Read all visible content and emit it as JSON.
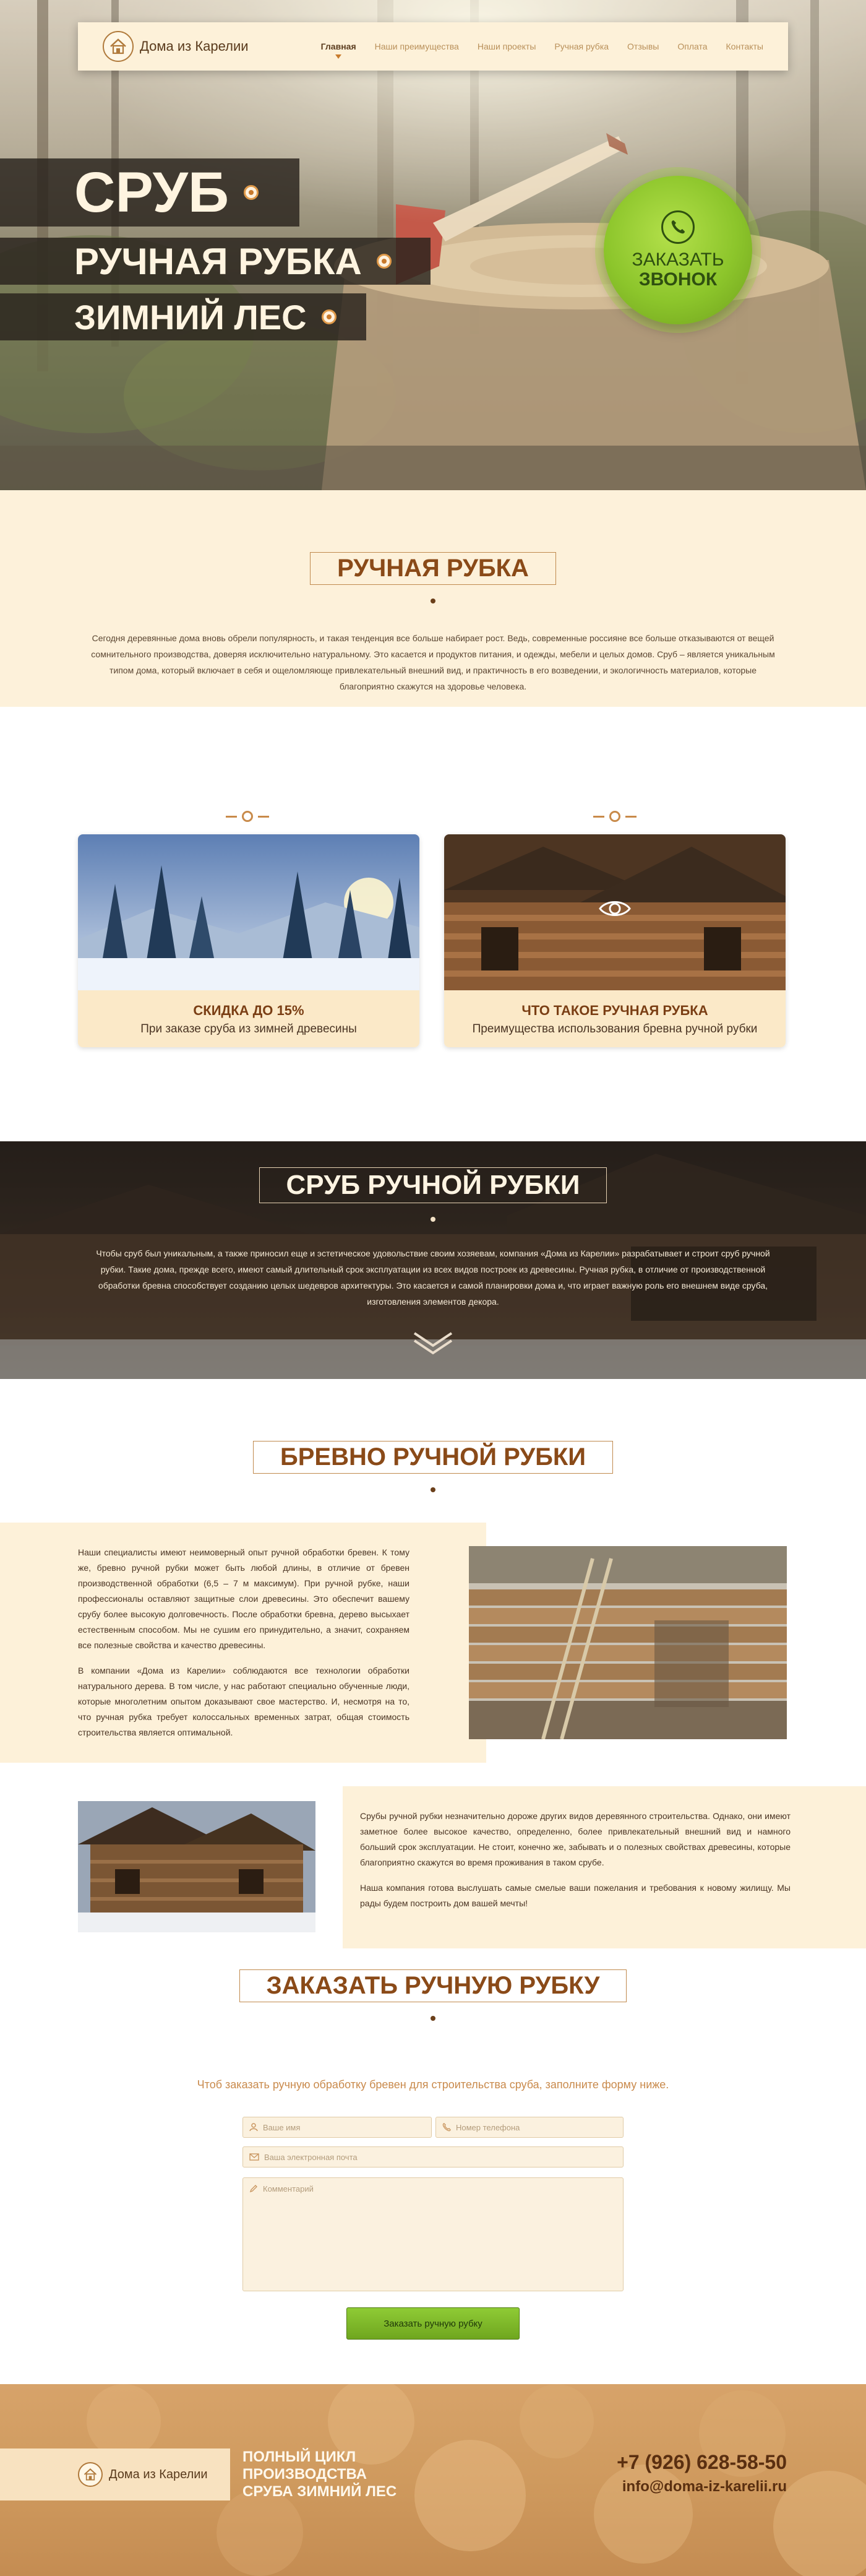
{
  "brand": {
    "name": "Дома из Карелии",
    "logo_icon": "house-icon"
  },
  "nav": {
    "items": [
      {
        "label": "Главная",
        "active": true
      },
      {
        "label": "Наши преимущества"
      },
      {
        "label": "Наши проекты"
      },
      {
        "label": "Ручная рубка"
      },
      {
        "label": "Отзывы"
      },
      {
        "label": "Оплата"
      },
      {
        "label": "Контакты"
      }
    ]
  },
  "hero": {
    "line1": "Сруб",
    "line2": "Ручная рубка",
    "line3": "Зимний лес",
    "call_button": {
      "line1": "Заказать",
      "line2": "звонок",
      "icon": "phone-icon"
    }
  },
  "section_intro": {
    "title": "Ручная рубка",
    "text": "Сегодня деревянные дома вновь обрели популярность, и такая тенденция все больше набирает рост. Ведь, современные россияне все больше отказываются от вещей сомнительного производства, доверяя исключительно натуральному. Это касается и продуктов питания, и одежды, мебели и целых домов. Сруб – является уникальным типом дома, который включает в себя и ощеломляюще привлекательный внешний вид, и практичность в его возведении, и экологичность материалов, которые благоприятно скажутся на здоровье человека."
  },
  "cards": [
    {
      "title": "Скидка до 15%",
      "subtitle": "При заказе сруба из зимней древесины"
    },
    {
      "title": "Что такое ручная рубка",
      "subtitle": "Преимущества использования бревна ручной рубки",
      "icon": "eye-icon"
    }
  ],
  "section_dark": {
    "title": "Сруб ручной рубки",
    "text": "Чтобы сруб был уникальным, а также приносил еще и эстетическое удовольствие своим хозяевам, компания «Дома из Карелии» разрабатывает и строит сруб ручной рубки. Такие дома, прежде всего, имеют самый длительный срок эксплуатации из всех видов построек из древесины. Ручная рубка, в отличие от производственной обработки бревна способствует созданию целых шедевров архитектуры. Это касается и самой планировки дома и, что играет важную роль его внешнем виде сруба, изготовления элементов декора.",
    "scroll_icon": "chevron-down-icon"
  },
  "section_log": {
    "title": "Бревно ручной рубки",
    "text1a": "Наши специалисты имеют неимоверный опыт ручной обработки бревен. К тому же, бревно ручной рубки может быть любой длины, в отличие от бревен производственной обработки (6,5 – 7 м максимум). При ручной рубке, наши профессионалы оставляют защитные слои древесины. Это обеспечит вашему срубу более высокую долговечность. После обработки бревна, дерево высыхает естественным способом. Мы не сушим его принудительно, а значит, сохраняем все полезные свойства и качество древесины.",
    "text1b": "В компании «Дома из Карелии» соблюдаются все технологии обработки натурального дерева. В том числе, у нас работают специально обученные люди, которые многолетним опытом доказывают свое мастерство. И, несмотря на то, что ручная рубка требует колоссальных временных затрат, общая стоимость строительства является оптимальной.",
    "text2a": "Срубы ручной рубки незначительно дороже других видов деревянного строительства. Однако, они имеют заметное более высокое качество, определенно, более привлекательный внешний вид и намного больший срок эксплуатации. Не стоит, конечно же, забывать и о полезных свойствах древесины, которые благоприятно скажутся во время проживания в таком срубе.",
    "text2b": "Наша компания готова выслушать самые смелые ваши пожелания и требования к новому жилищу. Мы рады будем построить дом вашей мечты!"
  },
  "order_form": {
    "title": "Заказать ручную рубку",
    "subtitle": "Чтоб заказать ручную обработку бревен для строительства сруба, заполните форму ниже.",
    "name_placeholder": "Ваше имя",
    "phone_placeholder": "Номер телефона",
    "email_placeholder": "Ваша электронная почта",
    "comment_placeholder": "Комментарий",
    "submit_label": "Заказать ручную рубку"
  },
  "footer": {
    "slogan_line1": "Полный цикл",
    "slogan_line2": "производства",
    "slogan_line3": "сруба зимний лес",
    "phone": "+7 (926) 628-58-50",
    "email": "info@doma-iz-karelii.ru"
  },
  "colors": {
    "accent": "#8a4a18",
    "cream": "#fdf1d9",
    "green": "#8cc52b"
  }
}
